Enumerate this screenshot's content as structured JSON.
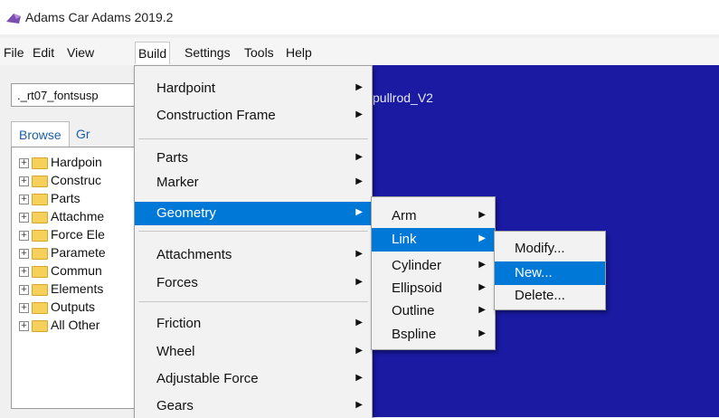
{
  "window": {
    "title": "Adams Car Adams 2019.2",
    "app_icon": "adams-car-icon"
  },
  "menubar": [
    "File",
    "Edit",
    "View",
    "Build",
    "Settings",
    "Tools",
    "Help"
  ],
  "model_field": {
    "value": "._rt07_fontsusp"
  },
  "tabs": [
    "Browse",
    "Gr"
  ],
  "tree": [
    "Hardpoin",
    "Construc",
    "Parts",
    "Attachme",
    "Force Ele",
    "Paramete",
    "Commun",
    "Elements",
    "Outputs",
    "All Other"
  ],
  "viewport": {
    "title": "pullrod_V2",
    "background": "#1a1aa3"
  },
  "build_menu": [
    {
      "label": "Hardpoint",
      "submenu": true
    },
    {
      "label": "Construction Frame",
      "submenu": true
    },
    {
      "label": "Parts",
      "submenu": true
    },
    {
      "label": "Marker",
      "submenu": true
    },
    {
      "label": "Geometry",
      "submenu": true,
      "highlighted": true
    },
    {
      "label": "Attachments",
      "submenu": true
    },
    {
      "label": "Forces",
      "submenu": true
    },
    {
      "label": "Friction",
      "submenu": true
    },
    {
      "label": "Wheel",
      "submenu": true
    },
    {
      "label": "Adjustable Force",
      "submenu": true
    },
    {
      "label": "Gears",
      "submenu": true
    }
  ],
  "geometry_menu": [
    {
      "label": "Arm",
      "submenu": true
    },
    {
      "label": "Link",
      "submenu": true,
      "highlighted": true
    },
    {
      "label": "Cylinder",
      "submenu": true
    },
    {
      "label": "Ellipsoid",
      "submenu": true
    },
    {
      "label": "Outline",
      "submenu": true
    },
    {
      "label": "Bspline",
      "submenu": true
    }
  ],
  "link_menu": [
    {
      "label": "Modify..."
    },
    {
      "label": "New...",
      "highlighted": true
    },
    {
      "label": "Delete..."
    }
  ],
  "colors": {
    "highlight": "#0078d7",
    "menu_bg": "#f2f2f2",
    "folder": "#f5d05a"
  }
}
